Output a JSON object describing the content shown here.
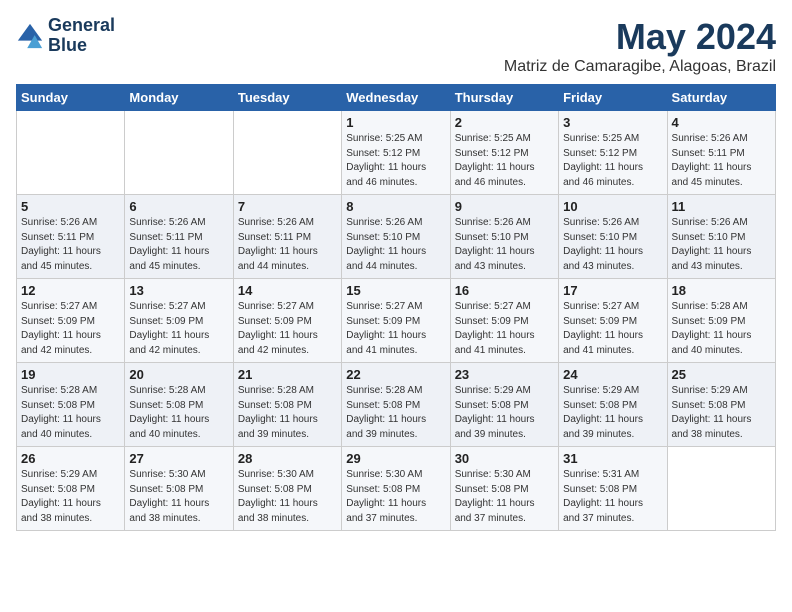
{
  "header": {
    "logo_line1": "General",
    "logo_line2": "Blue",
    "month_title": "May 2024",
    "location": "Matriz de Camaragibe, Alagoas, Brazil"
  },
  "days_of_week": [
    "Sunday",
    "Monday",
    "Tuesday",
    "Wednesday",
    "Thursday",
    "Friday",
    "Saturday"
  ],
  "weeks": [
    [
      {
        "day": "",
        "info": ""
      },
      {
        "day": "",
        "info": ""
      },
      {
        "day": "",
        "info": ""
      },
      {
        "day": "1",
        "info": "Sunrise: 5:25 AM\nSunset: 5:12 PM\nDaylight: 11 hours\nand 46 minutes."
      },
      {
        "day": "2",
        "info": "Sunrise: 5:25 AM\nSunset: 5:12 PM\nDaylight: 11 hours\nand 46 minutes."
      },
      {
        "day": "3",
        "info": "Sunrise: 5:25 AM\nSunset: 5:12 PM\nDaylight: 11 hours\nand 46 minutes."
      },
      {
        "day": "4",
        "info": "Sunrise: 5:26 AM\nSunset: 5:11 PM\nDaylight: 11 hours\nand 45 minutes."
      }
    ],
    [
      {
        "day": "5",
        "info": "Sunrise: 5:26 AM\nSunset: 5:11 PM\nDaylight: 11 hours\nand 45 minutes."
      },
      {
        "day": "6",
        "info": "Sunrise: 5:26 AM\nSunset: 5:11 PM\nDaylight: 11 hours\nand 45 minutes."
      },
      {
        "day": "7",
        "info": "Sunrise: 5:26 AM\nSunset: 5:11 PM\nDaylight: 11 hours\nand 44 minutes."
      },
      {
        "day": "8",
        "info": "Sunrise: 5:26 AM\nSunset: 5:10 PM\nDaylight: 11 hours\nand 44 minutes."
      },
      {
        "day": "9",
        "info": "Sunrise: 5:26 AM\nSunset: 5:10 PM\nDaylight: 11 hours\nand 43 minutes."
      },
      {
        "day": "10",
        "info": "Sunrise: 5:26 AM\nSunset: 5:10 PM\nDaylight: 11 hours\nand 43 minutes."
      },
      {
        "day": "11",
        "info": "Sunrise: 5:26 AM\nSunset: 5:10 PM\nDaylight: 11 hours\nand 43 minutes."
      }
    ],
    [
      {
        "day": "12",
        "info": "Sunrise: 5:27 AM\nSunset: 5:09 PM\nDaylight: 11 hours\nand 42 minutes."
      },
      {
        "day": "13",
        "info": "Sunrise: 5:27 AM\nSunset: 5:09 PM\nDaylight: 11 hours\nand 42 minutes."
      },
      {
        "day": "14",
        "info": "Sunrise: 5:27 AM\nSunset: 5:09 PM\nDaylight: 11 hours\nand 42 minutes."
      },
      {
        "day": "15",
        "info": "Sunrise: 5:27 AM\nSunset: 5:09 PM\nDaylight: 11 hours\nand 41 minutes."
      },
      {
        "day": "16",
        "info": "Sunrise: 5:27 AM\nSunset: 5:09 PM\nDaylight: 11 hours\nand 41 minutes."
      },
      {
        "day": "17",
        "info": "Sunrise: 5:27 AM\nSunset: 5:09 PM\nDaylight: 11 hours\nand 41 minutes."
      },
      {
        "day": "18",
        "info": "Sunrise: 5:28 AM\nSunset: 5:09 PM\nDaylight: 11 hours\nand 40 minutes."
      }
    ],
    [
      {
        "day": "19",
        "info": "Sunrise: 5:28 AM\nSunset: 5:08 PM\nDaylight: 11 hours\nand 40 minutes."
      },
      {
        "day": "20",
        "info": "Sunrise: 5:28 AM\nSunset: 5:08 PM\nDaylight: 11 hours\nand 40 minutes."
      },
      {
        "day": "21",
        "info": "Sunrise: 5:28 AM\nSunset: 5:08 PM\nDaylight: 11 hours\nand 39 minutes."
      },
      {
        "day": "22",
        "info": "Sunrise: 5:28 AM\nSunset: 5:08 PM\nDaylight: 11 hours\nand 39 minutes."
      },
      {
        "day": "23",
        "info": "Sunrise: 5:29 AM\nSunset: 5:08 PM\nDaylight: 11 hours\nand 39 minutes."
      },
      {
        "day": "24",
        "info": "Sunrise: 5:29 AM\nSunset: 5:08 PM\nDaylight: 11 hours\nand 39 minutes."
      },
      {
        "day": "25",
        "info": "Sunrise: 5:29 AM\nSunset: 5:08 PM\nDaylight: 11 hours\nand 38 minutes."
      }
    ],
    [
      {
        "day": "26",
        "info": "Sunrise: 5:29 AM\nSunset: 5:08 PM\nDaylight: 11 hours\nand 38 minutes."
      },
      {
        "day": "27",
        "info": "Sunrise: 5:30 AM\nSunset: 5:08 PM\nDaylight: 11 hours\nand 38 minutes."
      },
      {
        "day": "28",
        "info": "Sunrise: 5:30 AM\nSunset: 5:08 PM\nDaylight: 11 hours\nand 38 minutes."
      },
      {
        "day": "29",
        "info": "Sunrise: 5:30 AM\nSunset: 5:08 PM\nDaylight: 11 hours\nand 37 minutes."
      },
      {
        "day": "30",
        "info": "Sunrise: 5:30 AM\nSunset: 5:08 PM\nDaylight: 11 hours\nand 37 minutes."
      },
      {
        "day": "31",
        "info": "Sunrise: 5:31 AM\nSunset: 5:08 PM\nDaylight: 11 hours\nand 37 minutes."
      },
      {
        "day": "",
        "info": ""
      }
    ]
  ]
}
